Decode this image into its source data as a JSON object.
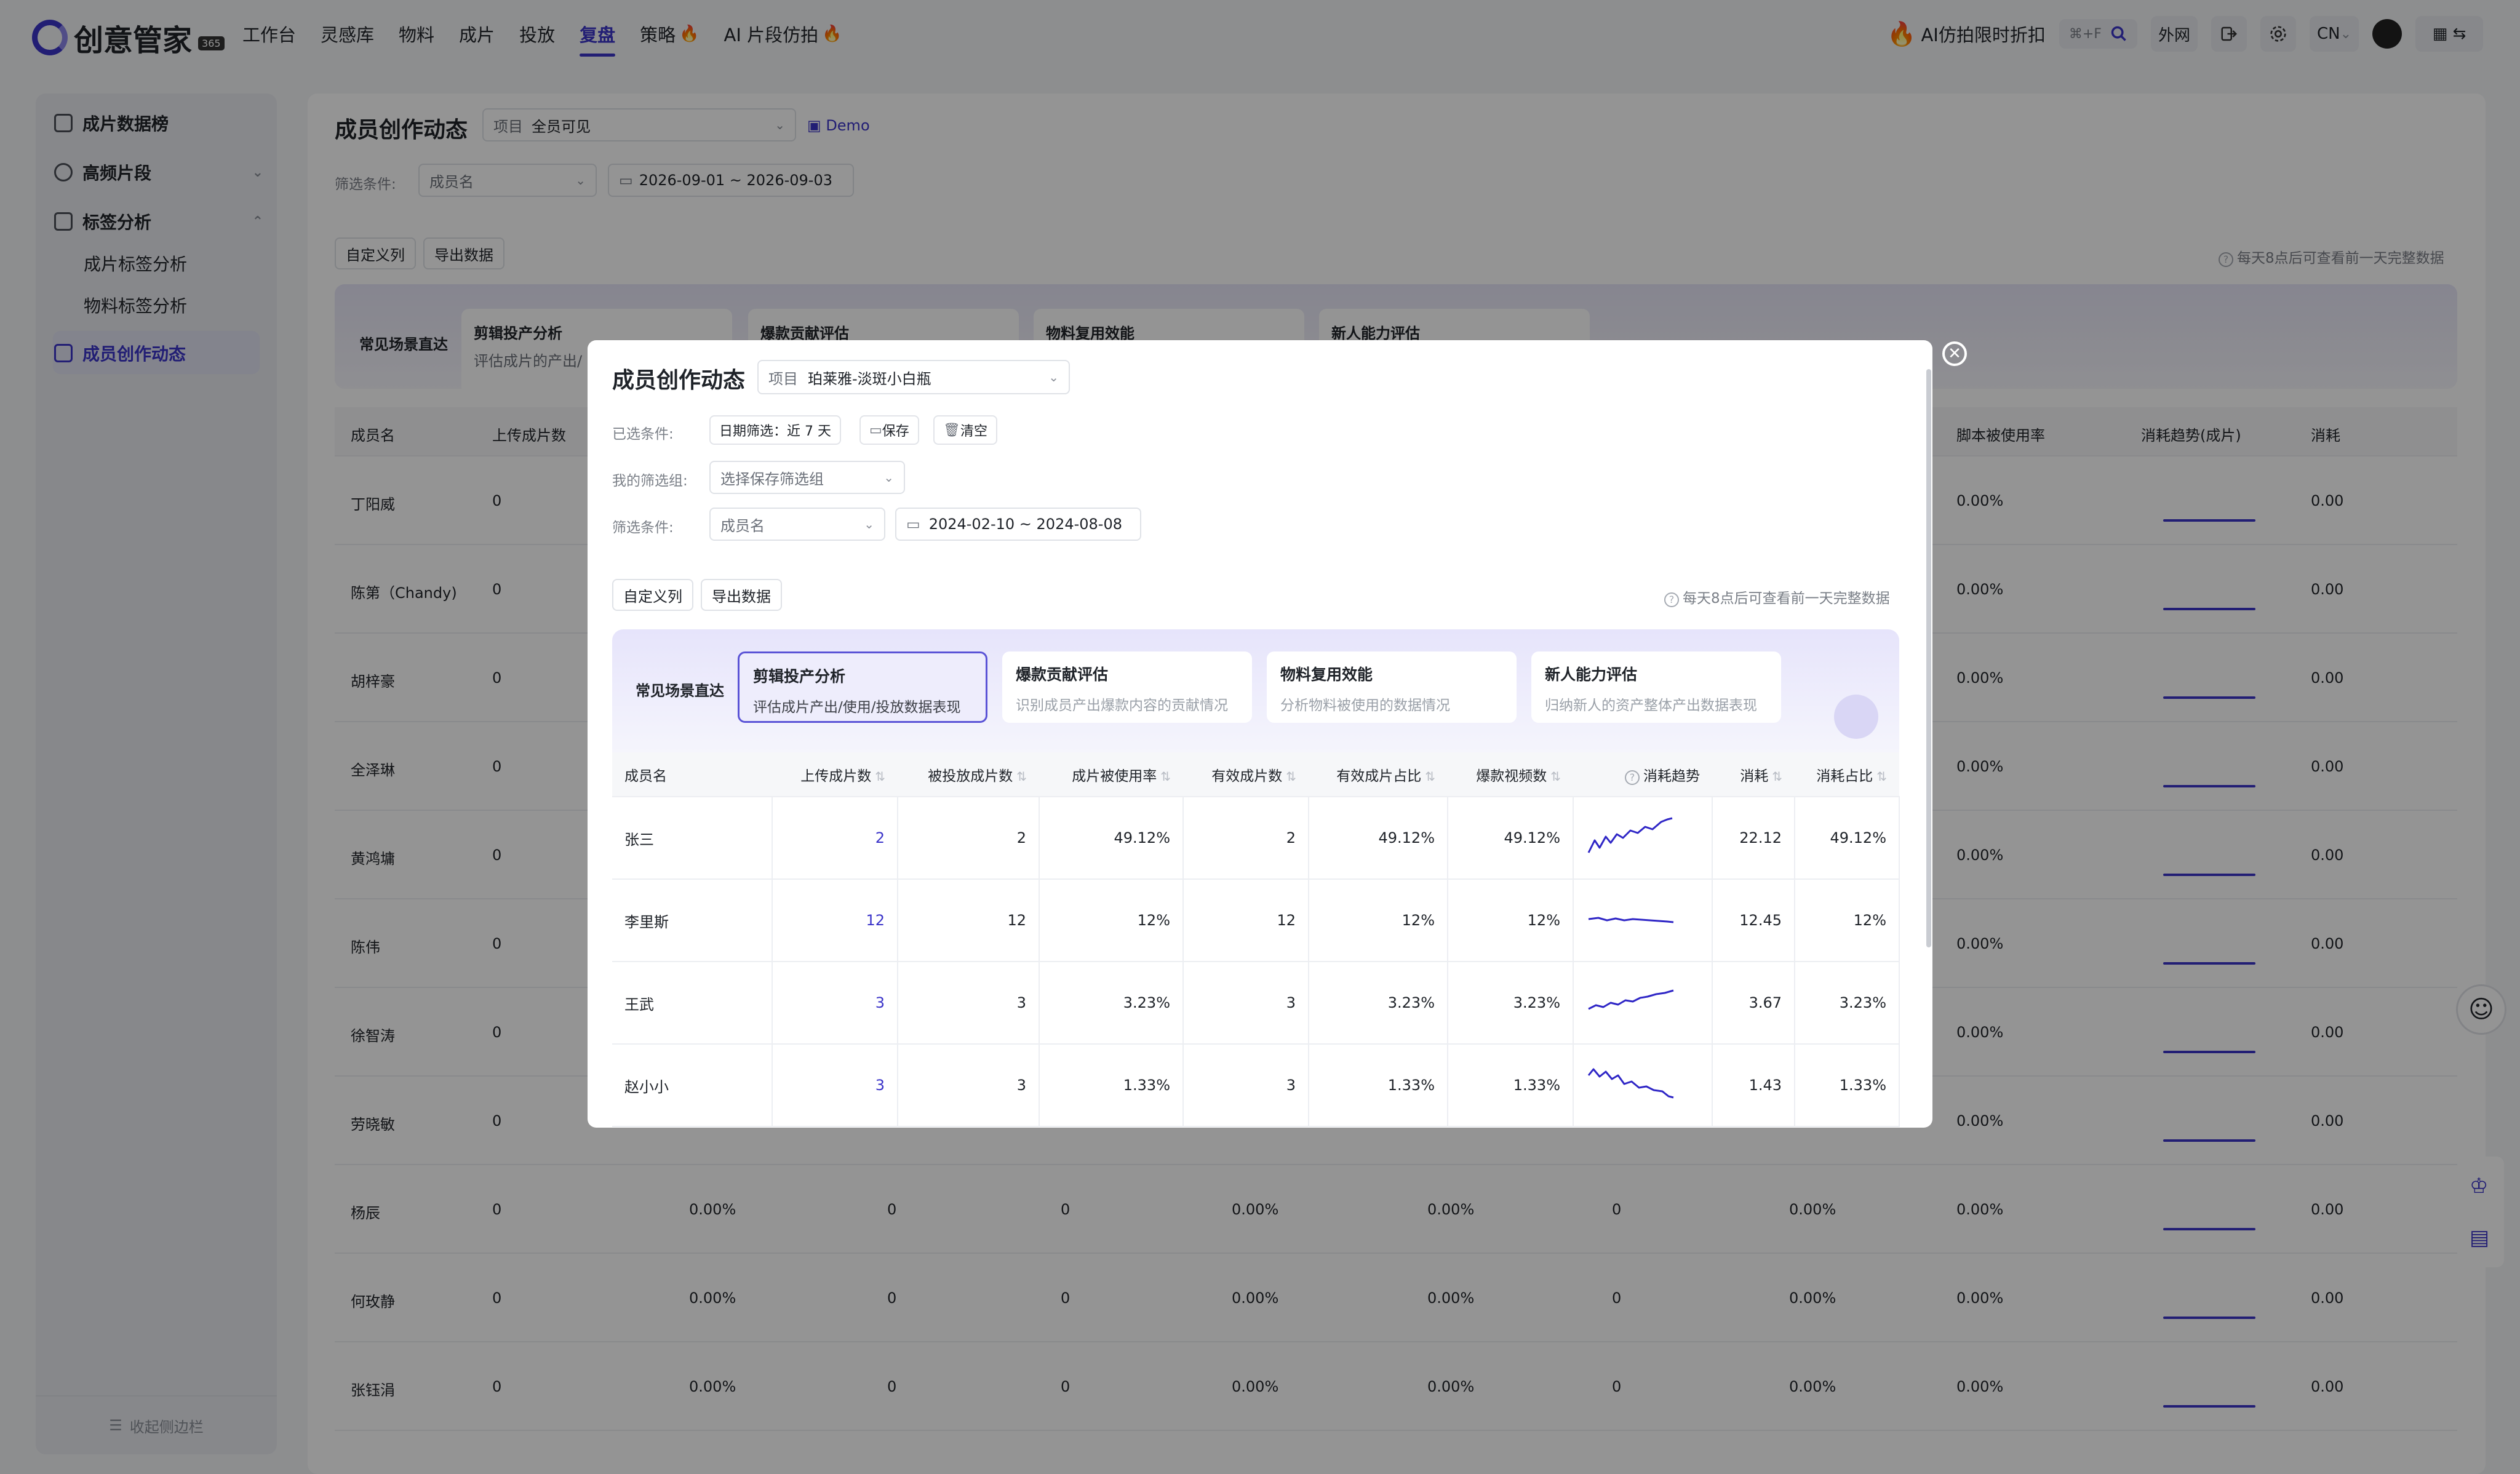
{
  "app": {
    "brand": "创意管家",
    "badge": "365"
  },
  "nav": {
    "items": [
      "工作台",
      "灵感库",
      "物料",
      "成片",
      "投放",
      "复盘",
      "策略",
      "AI 片段仿拍"
    ],
    "active": "复盘"
  },
  "topright": {
    "promo": "AI仿拍限时折扣",
    "shortcut": "⌘+F",
    "network": "外网",
    "lang": "CN"
  },
  "sidebar": {
    "items": [
      {
        "label": "成片数据榜"
      },
      {
        "label": "高频片段"
      },
      {
        "label": "标签分析"
      },
      {
        "label": "成片标签分析"
      },
      {
        "label": "物料标签分析"
      },
      {
        "label": "成员创作动态"
      }
    ],
    "footer": "收起侧边栏"
  },
  "page": {
    "title": "成员创作动态",
    "project_label": "项目",
    "project_value": "全员可见",
    "demo": "Demo",
    "filter_label": "筛选条件:",
    "member_placeholder": "成员名",
    "date_range": "2026-09-01 ~ 2026-09-03",
    "custom_cols": "自定义列",
    "export": "导出数据",
    "note": "每天8点后可查看前一天完整数据",
    "scene_title": "常见场景直达",
    "scenes": [
      "剪辑投产分析",
      "爆款贡献评估",
      "物料复用效能",
      "新人能力评估"
    ],
    "scene_sub": "评估成片的产出/",
    "bg_headers": [
      "成员名",
      "上传成片数",
      "脚本被使用率",
      "消耗趋势(成片)",
      "消耗"
    ],
    "bg_members": [
      "丁阳威",
      "陈第（Chandy)",
      "胡梓豪",
      "全泽琳",
      "黄鸿墉",
      "陈伟",
      "徐智涛",
      "劳晓敏",
      "杨辰",
      "何玫静",
      "张钰涓"
    ],
    "bg_zero": "0",
    "bg_pct": "0.00%",
    "bg_money": "0.00"
  },
  "modal": {
    "title": "成员创作动态",
    "project_label": "项目",
    "project_value": "珀莱雅-淡斑小白瓶",
    "selected_label": "已选条件:",
    "date_filter": "日期筛选：近 7 天",
    "save": "保存",
    "clear": "清空",
    "my_group_label": "我的筛选组:",
    "my_group_placeholder": "选择保存筛选组",
    "filter_label": "筛选条件:",
    "member_placeholder": "成员名",
    "date_range": "2024-02-10 ~ 2024-08-08",
    "custom_cols": "自定义列",
    "export": "导出数据",
    "note": "每天8点后可查看前一天完整数据",
    "scene_title": "常见场景直达",
    "scenes": [
      {
        "title": "剪辑投产分析",
        "sub": "评估成片产出/使用/投放数据表现"
      },
      {
        "title": "爆款贡献评估",
        "sub": "识别成员产出爆款内容的贡献情况"
      },
      {
        "title": "物料复用效能",
        "sub": "分析物料被使用的数据情况"
      },
      {
        "title": "新人能力评估",
        "sub": "归纳新人的资产整体产出数据表现"
      }
    ],
    "columns": [
      "成员名",
      "上传成片数",
      "被投放成片数",
      "成片被使用率",
      "有效成片数",
      "有效成片占比",
      "爆款视频数",
      "消耗趋势",
      "消耗",
      "消耗占比"
    ],
    "rows": [
      {
        "name": "张三",
        "upload": "2",
        "placed": "2",
        "use_rate": "49.12%",
        "valid": "2",
        "valid_ratio": "49.12%",
        "hits": "49.12%",
        "cost": "22.12",
        "cost_ratio": "49.12%"
      },
      {
        "name": "李里斯",
        "upload": "12",
        "placed": "12",
        "use_rate": "12%",
        "valid": "12",
        "valid_ratio": "12%",
        "hits": "12%",
        "cost": "12.45",
        "cost_ratio": "12%"
      },
      {
        "name": "王武",
        "upload": "3",
        "placed": "3",
        "use_rate": "3.23%",
        "valid": "3",
        "valid_ratio": "3.23%",
        "hits": "3.23%",
        "cost": "3.67",
        "cost_ratio": "3.23%"
      },
      {
        "name": "赵小小",
        "upload": "3",
        "placed": "3",
        "use_rate": "1.33%",
        "valid": "3",
        "valid_ratio": "1.33%",
        "hits": "1.33%",
        "cost": "1.43",
        "cost_ratio": "1.33%"
      }
    ]
  },
  "colors": {
    "accent": "#3b34c9",
    "fire": "#f56a00"
  }
}
